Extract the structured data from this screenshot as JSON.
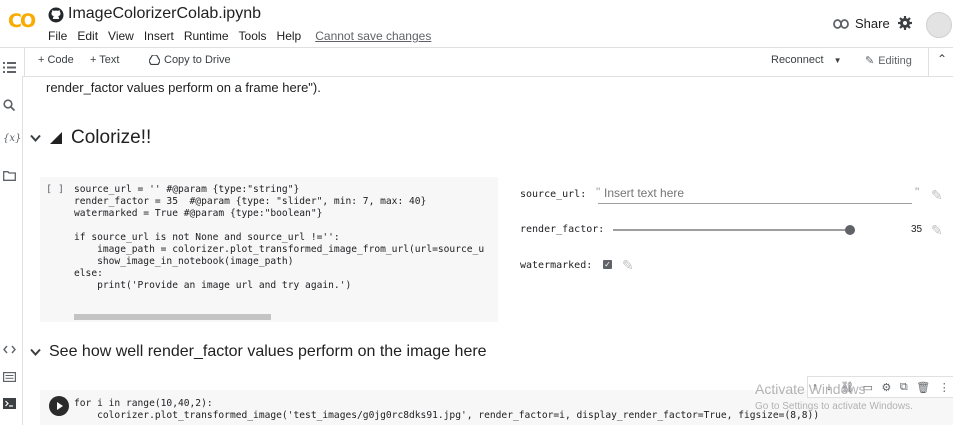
{
  "header": {
    "logo_text": "CO",
    "notebook_title": "ImageColorizerColab.ipynb",
    "menu": [
      "File",
      "Edit",
      "View",
      "Insert",
      "Runtime",
      "Tools",
      "Help"
    ],
    "save_status": "Cannot save changes",
    "share_label": "Share"
  },
  "toolbar": {
    "code_label": "+ Code",
    "text_label": "+ Text",
    "copy_label": "Copy to Drive",
    "reconnect_label": "Reconnect",
    "editing_label": "Editing"
  },
  "sidebar": {
    "icons": [
      "list-icon",
      "search-icon",
      "variables-icon",
      "folder-icon",
      "code-snippets-icon",
      "terminal-icon",
      "command-palette-icon"
    ],
    "variables_text": "{x}"
  },
  "content": {
    "snippet": "render_factor values perform on a frame here\").",
    "section1_title": "Colorize!!",
    "section2_title": "See how well render_factor values perform on the image here"
  },
  "cell1": {
    "bracket": "[ ]",
    "code_lines": [
      "source_url = '' #@param {type:\"string\"}",
      "render_factor = 35  #@param {type: \"slider\", min: 7, max: 40}",
      "watermarked = True #@param {type:\"boolean\"}",
      "",
      "if source_url is not None and source_url !='':",
      "    image_path = colorizer.plot_transformed_image_from_url(url=source_u",
      "    show_image_in_notebook(image_path)",
      "else:",
      "    print('Provide an image url and try again.')"
    ]
  },
  "form": {
    "source_url_label": "source_url:",
    "source_url_placeholder": "Insert text here",
    "render_factor_label": "render_factor:",
    "render_factor_value": "35",
    "render_factor_min": 7,
    "render_factor_max": 40,
    "watermarked_label": "watermarked:",
    "watermarked_checked": true
  },
  "cell2": {
    "code_lines": [
      "for i in range(10,40,2):",
      "    colorizer.plot_transformed_image('test_images/g0jg0rc8dks91.jpg', render_factor=i, display_render_factor=True, figsize=(8,8))"
    ]
  },
  "watermark": {
    "line1": "Activate Windows",
    "line2": "Go to Settings to activate Windows."
  }
}
